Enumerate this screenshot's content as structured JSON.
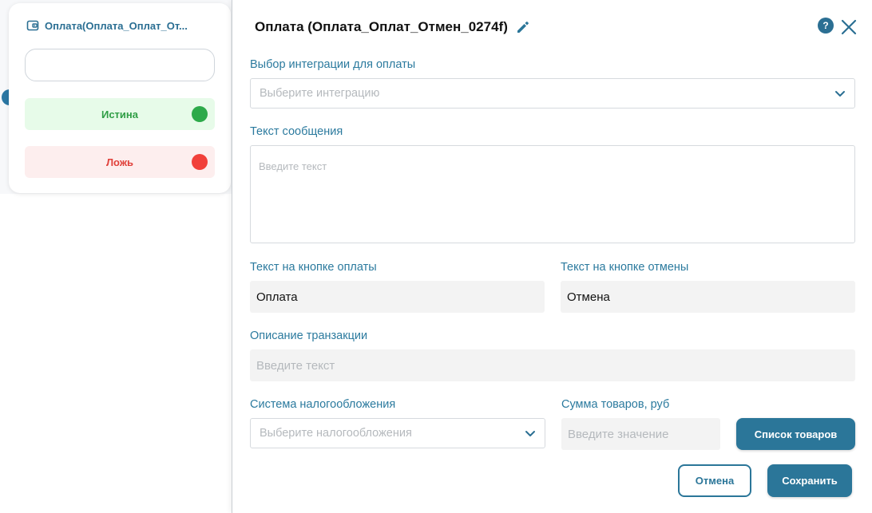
{
  "node": {
    "title": "Оплата(Оплата_Оплат_От...",
    "true_label": "Истина",
    "false_label": "Ложь",
    "icon": "wallet-icon"
  },
  "panel": {
    "title": "Оплата (Оплата_Оплат_Отмен_0274f)",
    "help_label": "?",
    "integration": {
      "label": "Выбор интеграции для оплаты",
      "placeholder": "Выберите интеграцию"
    },
    "message": {
      "label": "Текст сообщения",
      "placeholder": "Введите текст"
    },
    "pay_button_text": {
      "label": "Текст на кнопке оплаты",
      "value": "Оплата"
    },
    "cancel_button_text": {
      "label": "Текст на кнопке отмены",
      "value": "Отмена"
    },
    "description": {
      "label": "Описание транзакции",
      "placeholder": "Введите текст"
    },
    "tax": {
      "label": "Система налогообложения",
      "placeholder": "Выберите налогообложения"
    },
    "sum": {
      "label": "Сумма товаров, руб",
      "placeholder": "Введите значение"
    },
    "products_button": "Список товаров",
    "cancel_button": "Отмена",
    "save_button": "Сохранить"
  },
  "colors": {
    "accent": "#2b7699",
    "true": "#2daa4a",
    "false": "#f1403a"
  }
}
